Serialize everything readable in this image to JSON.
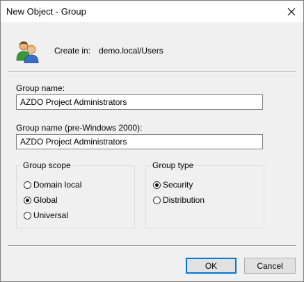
{
  "window": {
    "title": "New Object - Group"
  },
  "header": {
    "create_in_label": "Create in:",
    "create_in_value": "demo.local/Users",
    "icon": "users-icon"
  },
  "fields": {
    "group_name_label": "Group name:",
    "group_name_value": "AZDO Project Administrators",
    "group_name_pre2000_label": "Group name (pre-Windows 2000):",
    "group_name_pre2000_value": "AZDO Project Administrators"
  },
  "group_scope": {
    "legend": "Group scope",
    "options": [
      {
        "label": "Domain local",
        "checked": false
      },
      {
        "label": "Global",
        "checked": true
      },
      {
        "label": "Universal",
        "checked": false
      }
    ]
  },
  "group_type": {
    "legend": "Group type",
    "options": [
      {
        "label": "Security",
        "checked": true
      },
      {
        "label": "Distribution",
        "checked": false
      }
    ]
  },
  "buttons": {
    "ok": "OK",
    "cancel": "Cancel"
  },
  "colors": {
    "accent": "#0078d7",
    "dialog_bg": "#f0f0f0"
  }
}
